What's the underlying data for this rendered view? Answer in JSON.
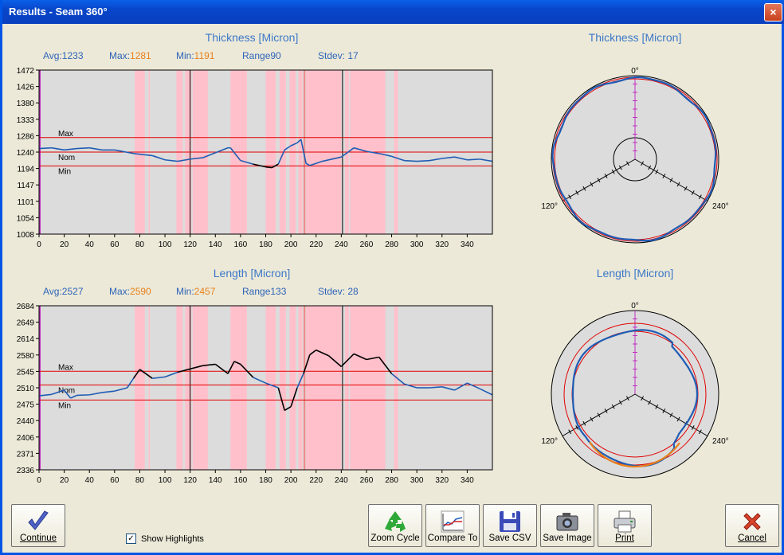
{
  "window": {
    "title": "Results - Seam 360°",
    "close": "×"
  },
  "charts": [
    {
      "id": "thk",
      "title": "Thickness [Micron]",
      "stats": [
        {
          "label": "Avg:",
          "value": "1233",
          "color": "#2e64b8"
        },
        {
          "label": "Max:",
          "value": "1281",
          "color": "#e8801a"
        },
        {
          "label": "Min:",
          "value": "1191",
          "color": "#e8801a"
        },
        {
          "label": "Range",
          "value": "90",
          "color": "#2e64b8"
        },
        {
          "label": "Stdev: ",
          "value": "17",
          "color": "#2e64b8"
        }
      ],
      "y_ticks": [
        "1472",
        "1426",
        "1380",
        "1333",
        "1286",
        "1240",
        "1194",
        "1147",
        "1101",
        "1054",
        "1008"
      ],
      "x_ticks": [
        "0",
        "20",
        "40",
        "60",
        "80",
        "100",
        "120",
        "140",
        "160",
        "180",
        "200",
        "220",
        "240",
        "260",
        "280",
        "300",
        "320",
        "340"
      ],
      "ref_labels": [
        "Max",
        "Nom",
        "Min"
      ]
    },
    {
      "id": "len",
      "title": "Length [Micron]",
      "stats": [
        {
          "label": "Avg:",
          "value": "2527",
          "color": "#2e64b8"
        },
        {
          "label": "Max:",
          "value": "2590",
          "color": "#e8801a"
        },
        {
          "label": "Min:",
          "value": "2457",
          "color": "#e8801a"
        },
        {
          "label": "Range",
          "value": "133",
          "color": "#2e64b8"
        },
        {
          "label": "Stdev: ",
          "value": "28",
          "color": "#2e64b8"
        }
      ],
      "y_ticks": [
        "2684",
        "2649",
        "2614",
        "2580",
        "2545",
        "2510",
        "2475",
        "2440",
        "2406",
        "2371",
        "2336"
      ],
      "x_ticks": [
        "0",
        "20",
        "40",
        "60",
        "80",
        "100",
        "120",
        "140",
        "160",
        "180",
        "200",
        "220",
        "240",
        "260",
        "280",
        "300",
        "320",
        "340"
      ],
      "ref_labels": [
        "Max",
        "Nom",
        "Min"
      ]
    }
  ],
  "chart_data": [
    {
      "type": "line",
      "title": "Thickness [Micron]",
      "ylim": [
        1008,
        1472
      ],
      "xlim": [
        0,
        360
      ],
      "ref_lines": {
        "max": 1281,
        "nom": 1240,
        "min": 1201
      },
      "highlights": [
        [
          76,
          84
        ],
        [
          87,
          88
        ],
        [
          109,
          114
        ],
        [
          116,
          121
        ],
        [
          122,
          134
        ],
        [
          152,
          165
        ],
        [
          180,
          188
        ],
        [
          191,
          196
        ],
        [
          199,
          204
        ],
        [
          206,
          209
        ],
        [
          212,
          240
        ],
        [
          243,
          246
        ],
        [
          247,
          275
        ],
        [
          282,
          285
        ]
      ],
      "series": [
        {
          "color": "#1f5cb4",
          "points": [
            [
              0,
              1250
            ],
            [
              10,
              1252
            ],
            [
              20,
              1246
            ],
            [
              30,
              1250
            ],
            [
              40,
              1252
            ],
            [
              50,
              1246
            ],
            [
              60,
              1246
            ],
            [
              75,
              1236
            ],
            [
              90,
              1230
            ],
            [
              100,
              1218
            ],
            [
              110,
              1214
            ],
            [
              120,
              1220
            ],
            [
              130,
              1224
            ],
            [
              140,
              1238
            ],
            [
              150,
              1252
            ],
            [
              152,
              1252
            ],
            [
              160,
              1216
            ],
            [
              170,
              1206
            ],
            [
              180,
              1198
            ],
            [
              185,
              1196
            ],
            [
              190,
              1206
            ],
            [
              195,
              1246
            ],
            [
              200,
              1258
            ],
            [
              205,
              1266
            ],
            [
              208,
              1276
            ],
            [
              212,
              1208
            ],
            [
              215,
              1202
            ],
            [
              225,
              1214
            ],
            [
              240,
              1226
            ],
            [
              250,
              1252
            ],
            [
              260,
              1242
            ],
            [
              270,
              1236
            ],
            [
              280,
              1228
            ],
            [
              290,
              1216
            ],
            [
              300,
              1214
            ],
            [
              310,
              1216
            ],
            [
              320,
              1222
            ],
            [
              330,
              1226
            ],
            [
              340,
              1218
            ],
            [
              350,
              1220
            ],
            [
              360,
              1214
            ]
          ]
        }
      ]
    },
    {
      "type": "line",
      "title": "Length [Micron]",
      "ylim": [
        2336,
        2684
      ],
      "xlim": [
        0,
        360
      ],
      "ref_lines": {
        "max": 2545,
        "nom": 2516,
        "min": 2484
      },
      "highlights": [
        [
          76,
          84
        ],
        [
          87,
          88
        ],
        [
          109,
          114
        ],
        [
          116,
          121
        ],
        [
          122,
          134
        ],
        [
          152,
          165
        ],
        [
          180,
          188
        ],
        [
          191,
          196
        ],
        [
          199,
          204
        ],
        [
          206,
          209
        ],
        [
          212,
          240
        ],
        [
          243,
          246
        ],
        [
          247,
          275
        ],
        [
          282,
          285
        ]
      ],
      "series": [
        {
          "color": "#1f5cb4",
          "points": [
            [
              0,
              2493
            ],
            [
              10,
              2496
            ],
            [
              20,
              2505
            ],
            [
              25,
              2488
            ],
            [
              30,
              2494
            ],
            [
              40,
              2495
            ],
            [
              50,
              2500
            ],
            [
              60,
              2503
            ],
            [
              70,
              2510
            ],
            [
              75,
              2530
            ],
            [
              80,
              2549
            ],
            [
              90,
              2530
            ],
            [
              100,
              2533
            ],
            [
              110,
              2543
            ],
            [
              120,
              2550
            ],
            [
              130,
              2557
            ],
            [
              140,
              2560
            ],
            [
              150,
              2540
            ],
            [
              155,
              2566
            ],
            [
              160,
              2560
            ],
            [
              170,
              2532
            ],
            [
              180,
              2520
            ],
            [
              190,
              2510
            ],
            [
              195,
              2462
            ],
            [
              200,
              2470
            ],
            [
              205,
              2510
            ],
            [
              210,
              2540
            ],
            [
              215,
              2580
            ],
            [
              220,
              2590
            ],
            [
              230,
              2578
            ],
            [
              240,
              2555
            ],
            [
              250,
              2582
            ],
            [
              260,
              2570
            ],
            [
              270,
              2575
            ],
            [
              280,
              2540
            ],
            [
              290,
              2518
            ],
            [
              300,
              2510
            ],
            [
              310,
              2510
            ],
            [
              320,
              2512
            ],
            [
              330,
              2505
            ],
            [
              340,
              2520
            ],
            [
              350,
              2508
            ],
            [
              360,
              2495
            ]
          ]
        }
      ]
    },
    {
      "type": "polar",
      "title": "Thickness [Micron]",
      "angle_labels": [
        "0°",
        "120°",
        "240°"
      ]
    },
    {
      "type": "polar",
      "title": "Length [Micron]",
      "angle_labels": [
        "0°",
        "120°",
        "240°"
      ]
    }
  ],
  "polars": [
    {
      "title": "Thickness [Micron]",
      "labels": [
        "0°",
        "120°",
        "240°"
      ]
    },
    {
      "title": "Length [Micron]",
      "labels": [
        "0°",
        "120°",
        "240°"
      ]
    }
  ],
  "footer": {
    "show_highlights": "Show Highlights",
    "check": "✓"
  },
  "buttons": {
    "continue": "Continue",
    "zoom": "Zoom Cycle",
    "compare": "Compare To",
    "save_csv": "Save CSV",
    "save_image": "Save Image",
    "print": "Print",
    "cancel": "Cancel"
  },
  "colors": {
    "series": "#1f5cb4",
    "over": "#000000",
    "ref": "#e10000",
    "highlight": "#ffc0cb",
    "title": "#3c78c8",
    "stat": "#2e64b8",
    "extreme": "#e8801a"
  }
}
